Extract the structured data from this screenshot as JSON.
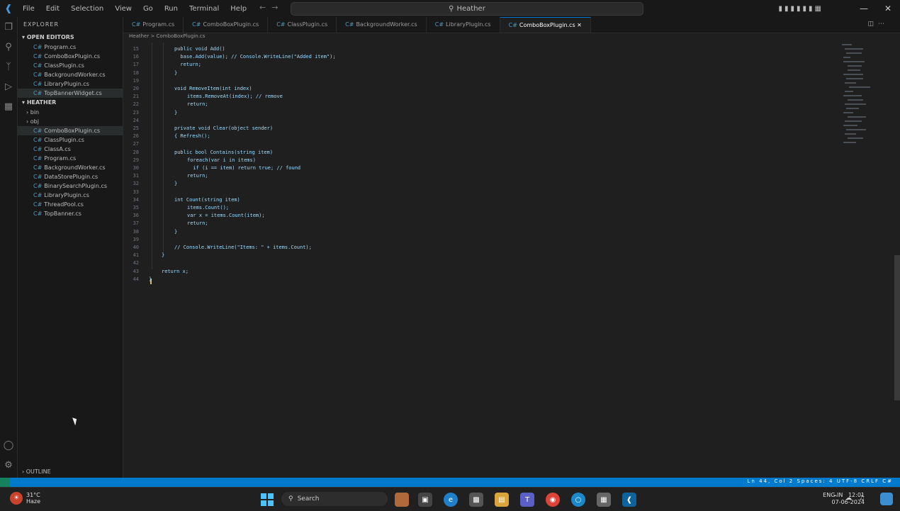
{
  "titlebar": {
    "menus": [
      "File",
      "Edit",
      "Selection",
      "View",
      "Go",
      "Run",
      "Terminal",
      "Help"
    ],
    "search_text": "Heather"
  },
  "sidebar": {
    "header": "EXPLORER",
    "open_editors": "OPEN EDITORS",
    "open_files": [
      "Program.cs",
      "ComboBoxPlugin.cs",
      "ClassPlugin.cs",
      "BackgroundWorker.cs",
      "LibraryPlugin.cs",
      "TopBannerWidget.cs"
    ],
    "project": "HEATHER",
    "folders": [
      "bin",
      "obj"
    ],
    "files": [
      "ComboBoxPlugin.cs",
      "ClassPlugin.cs",
      "ClassA.cs",
      "Program.cs",
      "BackgroundWorker.cs",
      "DataStorePlugin.cs",
      "BinarySearchPlugin.cs",
      "LibraryPlugin.cs",
      "ThreadPool.cs",
      "TopBanner.cs"
    ],
    "bottom": "OUTLINE"
  },
  "tabs": [
    {
      "label": "Program.cs",
      "active": false
    },
    {
      "label": "ComboBoxPlugin.cs",
      "active": false
    },
    {
      "label": "ClassPlugin.cs",
      "active": false
    },
    {
      "label": "BackgroundWorker.cs",
      "active": false
    },
    {
      "label": "LibraryPlugin.cs",
      "active": false
    },
    {
      "label": "ComboBoxPlugin.cs",
      "active": true
    }
  ],
  "breadcrumb": "Heather > ComboBoxPlugin.cs",
  "code": [
    {
      "n": "15",
      "indent": 4,
      "text": "public void Add()"
    },
    {
      "n": "16",
      "indent": 4,
      "text": "  base.Add(value); // Console.WriteLine(\"Added item\");"
    },
    {
      "n": "17",
      "indent": 4,
      "text": "  return;"
    },
    {
      "n": "18",
      "indent": 4,
      "text": "}"
    },
    {
      "n": "19",
      "indent": 4,
      "text": ""
    },
    {
      "n": "20",
      "indent": 4,
      "text": "void RemoveItem(int index)"
    },
    {
      "n": "21",
      "indent": 6,
      "text": "items.RemoveAt(index); // remove"
    },
    {
      "n": "22",
      "indent": 6,
      "text": "return;"
    },
    {
      "n": "23",
      "indent": 4,
      "text": "}"
    },
    {
      "n": "24",
      "indent": 4,
      "text": ""
    },
    {
      "n": "25",
      "indent": 4,
      "text": "private void Clear(object sender)"
    },
    {
      "n": "26",
      "indent": 4,
      "text": "{ Refresh();"
    },
    {
      "n": "27",
      "indent": 4,
      "text": ""
    },
    {
      "n": "28",
      "indent": 4,
      "text": "public bool Contains(string item)"
    },
    {
      "n": "29",
      "indent": 6,
      "text": "foreach(var i in items)"
    },
    {
      "n": "30",
      "indent": 6,
      "text": "  if (i == item) return true; // found"
    },
    {
      "n": "31",
      "indent": 6,
      "text": "return;"
    },
    {
      "n": "32",
      "indent": 4,
      "text": "}"
    },
    {
      "n": "33",
      "indent": 4,
      "text": ""
    },
    {
      "n": "34",
      "indent": 4,
      "text": "int Count(string item)"
    },
    {
      "n": "35",
      "indent": 6,
      "text": "items.Count();"
    },
    {
      "n": "36",
      "indent": 6,
      "text": "var x = items.Count(item);"
    },
    {
      "n": "37",
      "indent": 6,
      "text": "return;"
    },
    {
      "n": "38",
      "indent": 4,
      "text": "}"
    },
    {
      "n": "39",
      "indent": 4,
      "text": ""
    },
    {
      "n": "40",
      "indent": 4,
      "text": "// Console.WriteLine(\"Items: \" + items.Count);"
    },
    {
      "n": "41",
      "indent": 2,
      "text": "}"
    },
    {
      "n": "42",
      "indent": 2,
      "text": ""
    },
    {
      "n": "43",
      "indent": 2,
      "text": "return x;"
    },
    {
      "n": "44",
      "indent": 0,
      "text": "}"
    }
  ],
  "statusbar": {
    "right": "Ln 44, Col 2  Spaces: 4  UTF-8  CRLF  C#"
  },
  "taskbar": {
    "weather_temp": "31°C",
    "weather_desc": "Haze",
    "search_label": "Search",
    "time": "12:01",
    "date": "07-06-2024",
    "lang": "ENG IN"
  },
  "colors": {
    "accent": "#007acc",
    "editor_bg": "#1f1f1f",
    "sidebar_bg": "#181818"
  }
}
